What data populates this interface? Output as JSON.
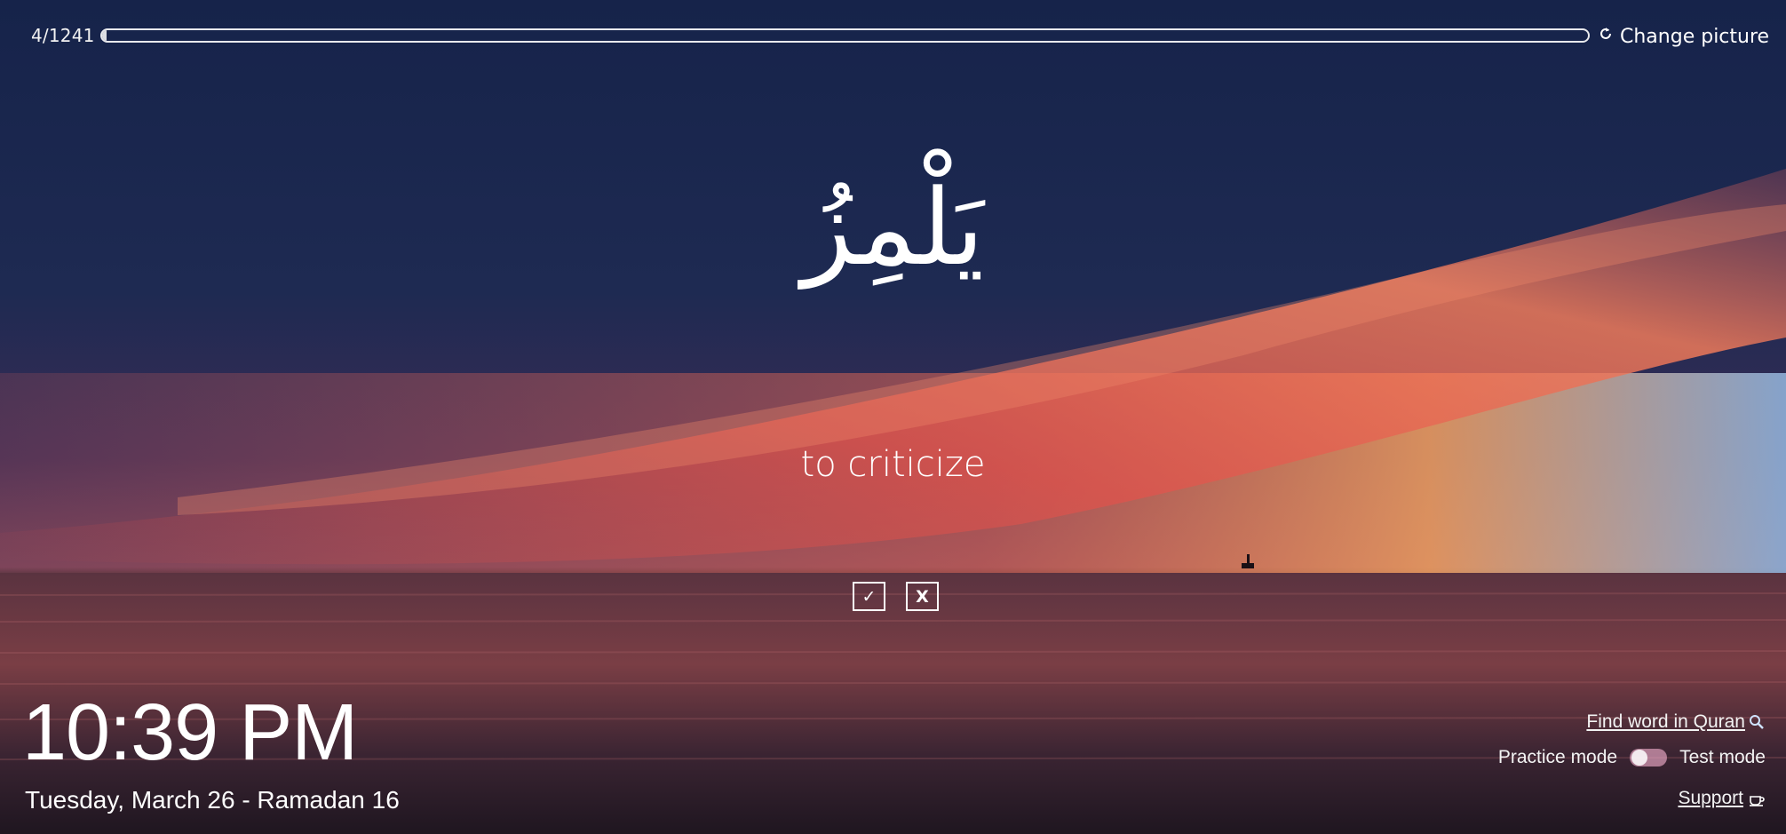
{
  "progress": {
    "count_label": "4/1241",
    "fraction": 0.0032
  },
  "toolbar": {
    "change_picture_label": "Change picture",
    "change_picture_icon": "refresh-icon"
  },
  "flashcard": {
    "arabic_word": "يَلْمِزُ",
    "english_meaning": "to criticize",
    "correct_button_label": "✓",
    "wrong_button_label": "X"
  },
  "clock": {
    "time": "10:39 PM",
    "date": "Tuesday, March 26 - Ramadan 16"
  },
  "footer_links": {
    "find_word_label": "Find word in Quran",
    "find_word_icon": "magnifier-icon",
    "practice_mode_label": "Practice mode",
    "test_mode_label": "Test mode",
    "support_label": "Support",
    "support_icon": "coffee-cup-icon"
  },
  "colors": {
    "sky_top": "#17244a",
    "sunset_red": "#e2574c",
    "horizon_glow": "#f0a06a",
    "sea_dark": "#2a1f2e",
    "toggle_track": "#ecaac8"
  }
}
